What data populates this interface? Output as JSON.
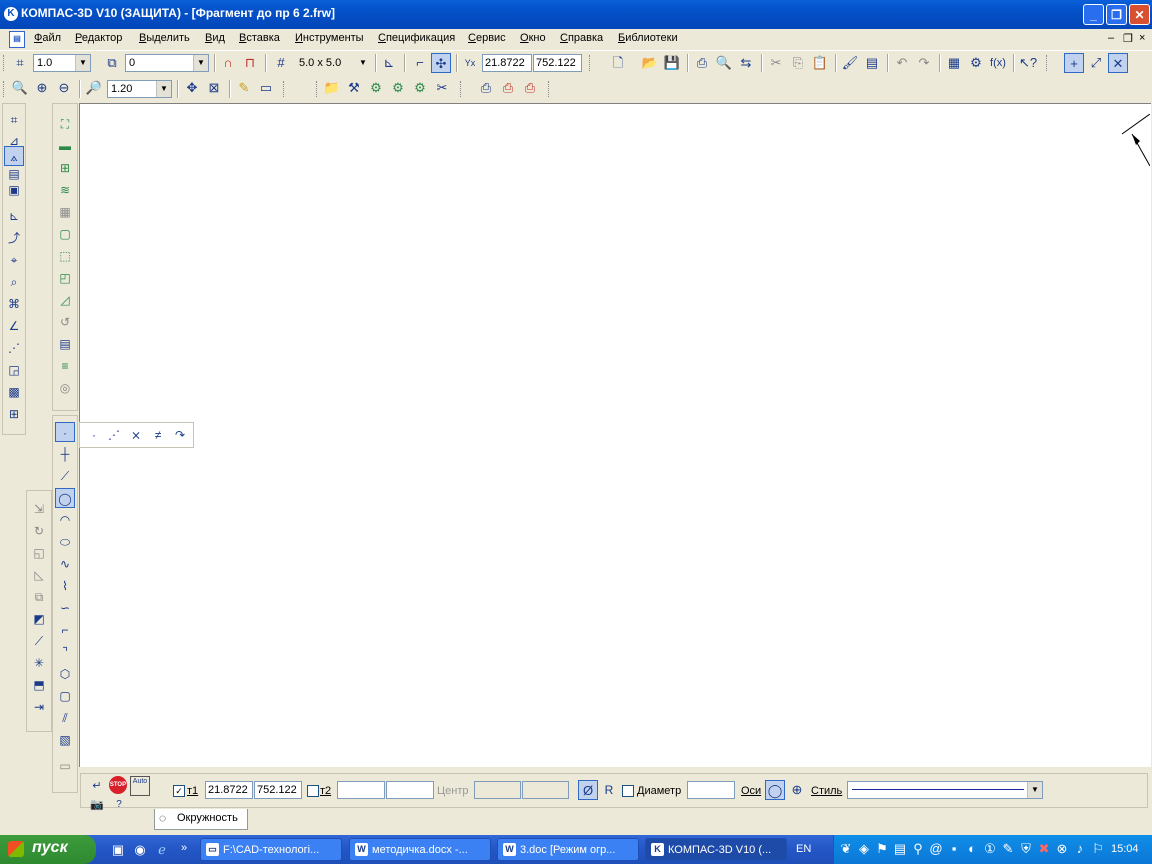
{
  "window": {
    "title": "КОМПАС-3D V10 (ЗАЩИТА) - [Фрагмент до пр 6  2.frw]",
    "app_icon": "K",
    "minimize": "_",
    "restore": "❐",
    "close": "✕"
  },
  "menu": {
    "items": [
      "Файл",
      "Редактор",
      "Выделить",
      "Вид",
      "Вставка",
      "Инструменты",
      "Спецификация",
      "Сервис",
      "Окно",
      "Справка",
      "Библиотеки"
    ],
    "mdi_minimize": "–",
    "mdi_restore": "❐",
    "mdi_close": "×"
  },
  "toolbar1": {
    "step_value": "1.0",
    "layer_value": "0",
    "grid_value": "5.0 x 5.0",
    "coord_x": "21.8722",
    "coord_y": "752.122"
  },
  "toolbar2": {
    "zoom_value": "1.20"
  },
  "propbar": {
    "t1_label": "т1",
    "t1_x": "21.8722",
    "t1_y": "752.122",
    "t2_label": "т2",
    "t2_x": "",
    "t2_y": "",
    "center_label": "Центр",
    "center_x": "",
    "center_y": "",
    "diameter_btn": "Ø",
    "radius_btn": "R",
    "diameter_label": "Диаметр",
    "diameter_value": "",
    "axes_label": "Оси",
    "style_label": "Стиль",
    "tab_label": "Окружность",
    "auto_label": "Auto",
    "stop_label": "STOP"
  },
  "colors": {
    "titlebar": "#0450c8",
    "taskbar": "#2456c6",
    "start": "#2f8a2f",
    "accent": "#316ac5"
  },
  "taskbar": {
    "start_label": "пуск",
    "tasks": [
      {
        "label": "F:\\CAD-технологі...",
        "active": false
      },
      {
        "label": "методичка.docx -...",
        "active": false
      },
      {
        "label": "3.doc [Режим огр...",
        "active": false
      },
      {
        "label": "КОМПАС-3D V10 (...",
        "active": true
      }
    ],
    "lang": "EN",
    "clock": "15:04"
  }
}
